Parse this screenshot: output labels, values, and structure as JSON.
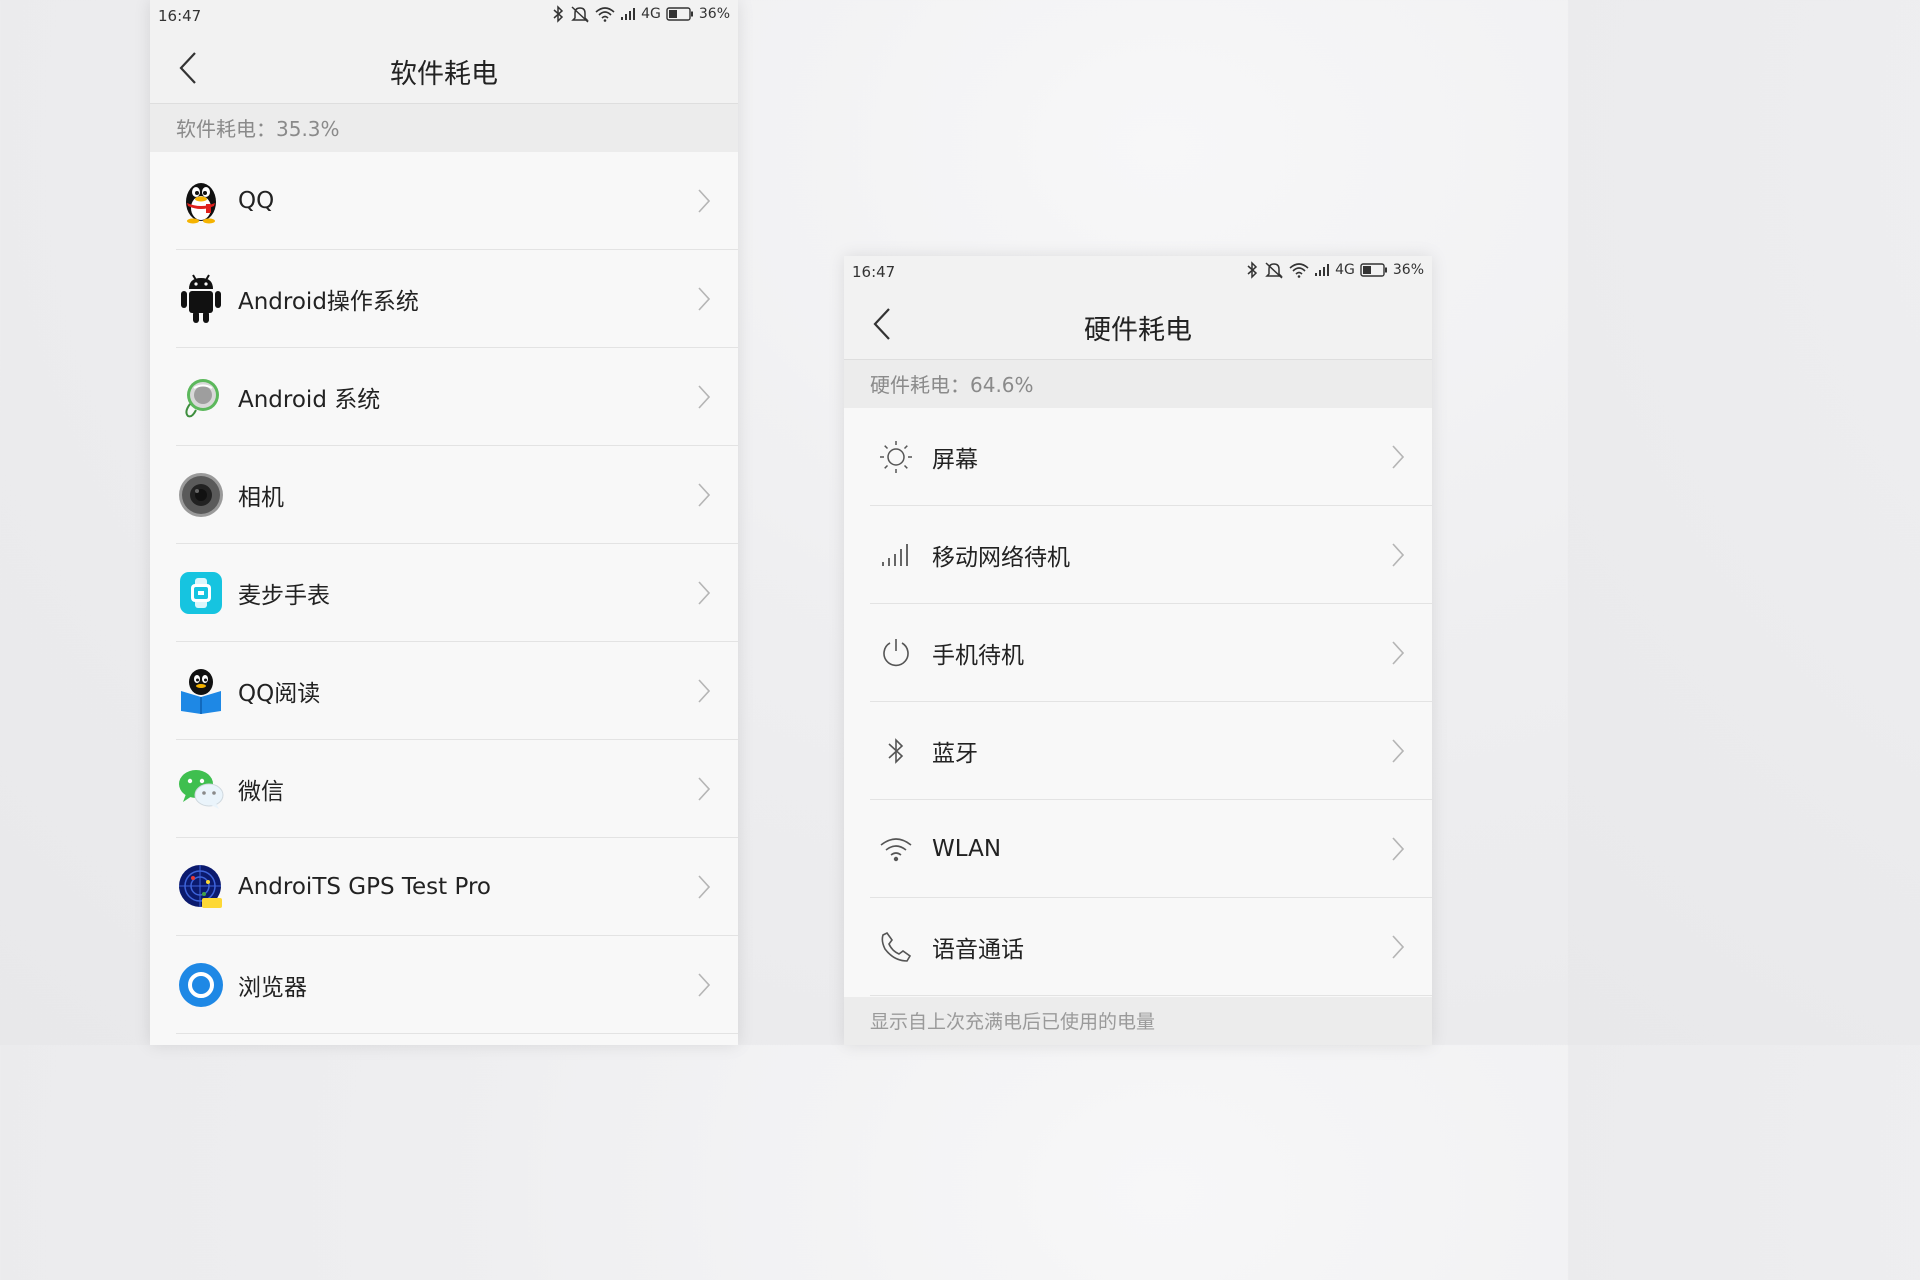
{
  "left_screen": {
    "status": {
      "time": "16:47",
      "network": "4G",
      "battery": "36%"
    },
    "title": "软件耗电",
    "summary": "软件耗电：35.3%",
    "items": [
      {
        "label": "QQ",
        "icon": "qq-penguin-icon"
      },
      {
        "label": "Android操作系统",
        "icon": "android-robot-icon"
      },
      {
        "label": "Android 系统",
        "icon": "android-system-icon"
      },
      {
        "label": "相机",
        "icon": "camera-icon"
      },
      {
        "label": "麦步手表",
        "icon": "watch-app-icon"
      },
      {
        "label": "QQ阅读",
        "icon": "qq-reader-icon"
      },
      {
        "label": "微信",
        "icon": "wechat-icon"
      },
      {
        "label": "AndroiTS GPS Test Pro",
        "icon": "gps-test-icon"
      },
      {
        "label": "浏览器",
        "icon": "browser-icon"
      }
    ]
  },
  "right_screen": {
    "status": {
      "time": "16:47",
      "network": "4G",
      "battery": "36%"
    },
    "title": "硬件耗电",
    "summary": "硬件耗电：64.6%",
    "items": [
      {
        "label": "屏幕",
        "icon": "brightness-icon"
      },
      {
        "label": "移动网络待机",
        "icon": "signal-bars-icon"
      },
      {
        "label": "手机待机",
        "icon": "power-icon"
      },
      {
        "label": "蓝牙",
        "icon": "bluetooth-icon"
      },
      {
        "label": "WLAN",
        "icon": "wifi-icon"
      },
      {
        "label": "语音通话",
        "icon": "phone-icon"
      }
    ],
    "footer": "显示自上次充满电后已使用的电量"
  },
  "colors": {
    "accent_blue": "#1e88e5",
    "android_black": "#111111",
    "wechat_green": "#3fbf4f",
    "watch_cyan": "#16c4e0",
    "qq_red": "#e0201c",
    "qq_yellow": "#f5b300"
  }
}
